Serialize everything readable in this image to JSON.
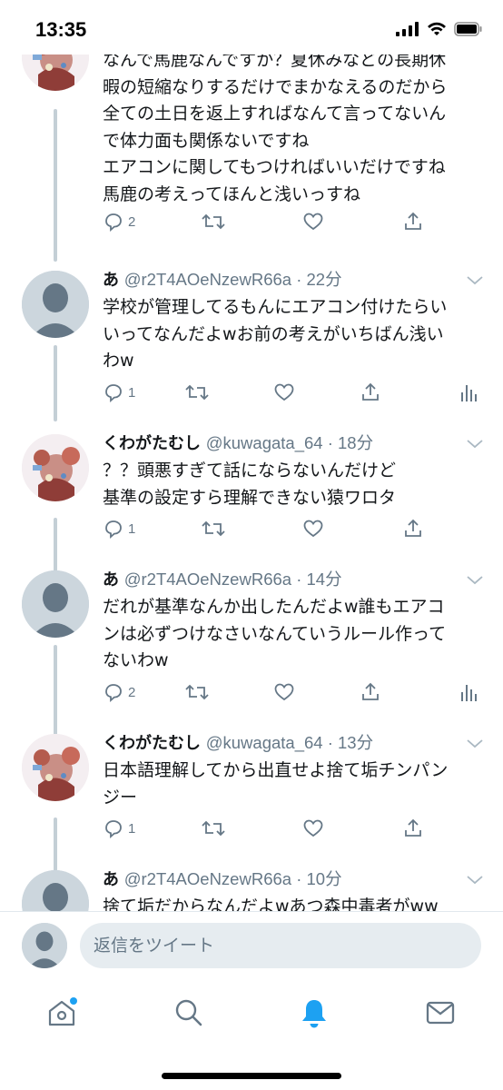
{
  "status_bar": {
    "time": "13:35"
  },
  "tweets": [
    {
      "name": "",
      "handle": "",
      "body": "なんで馬鹿なんですか？夏休みなどの長期休\n暇の短縮なりするだけでまかなえるのだから\n全ての土日を返上すればなんて言ってないん\nで体力面も関係ないですね\nエアコンに関してもつければいいだけですね\n馬鹿の考えってほんと浅いっすね",
      "reply_count": "2",
      "avatar": "character"
    },
    {
      "name": "あ",
      "handle": "@r2T4AOeNzewR66a · 22分",
      "body": "学校が管理してるもんにエアコン付けたらい\nいってなんだよwお前の考えがいちばん浅い\nわw",
      "reply_count": "1",
      "avatar": "default"
    },
    {
      "name": "くわがたむし",
      "handle": "@kuwagata_64 · 18分",
      "body": "？？頭悪すぎて話にならないんだけど\n基準の設定すら理解できない猿ワロタ",
      "reply_count": "1",
      "avatar": "character"
    },
    {
      "name": "あ",
      "handle": "@r2T4AOeNzewR66a · 14分",
      "body": "だれが基準なんか出したんだよw誰もエアコ\nンは必ずつけなさいなんていうルール作って\nないわw",
      "reply_count": "2",
      "avatar": "default"
    },
    {
      "name": "くわがたむし",
      "handle": "@kuwagata_64 · 13分",
      "body": "日本語理解してから出直せよ捨て垢チンパン\nジー",
      "reply_count": "1",
      "avatar": "character"
    },
    {
      "name": "あ",
      "handle": "@r2T4AOeNzewR66a · 10分",
      "body": "捨て垢だからなんだよwあつ森中毒者がww",
      "reply_count": "",
      "avatar": "default"
    }
  ],
  "composer": {
    "placeholder": "返信をツイート"
  },
  "colors": {
    "accent": "#1da1f2",
    "icon_gray": "#657786",
    "line": "#c4cfd6",
    "notification_dot": "#1da1f2"
  },
  "icons": {
    "reply": "reply-icon",
    "retweet": "retweet-icon",
    "like": "like-icon",
    "share": "share-icon",
    "analytics": "analytics-icon",
    "home": "home-icon",
    "search": "search-icon",
    "notifications": "bell-icon",
    "messages": "mail-icon"
  }
}
